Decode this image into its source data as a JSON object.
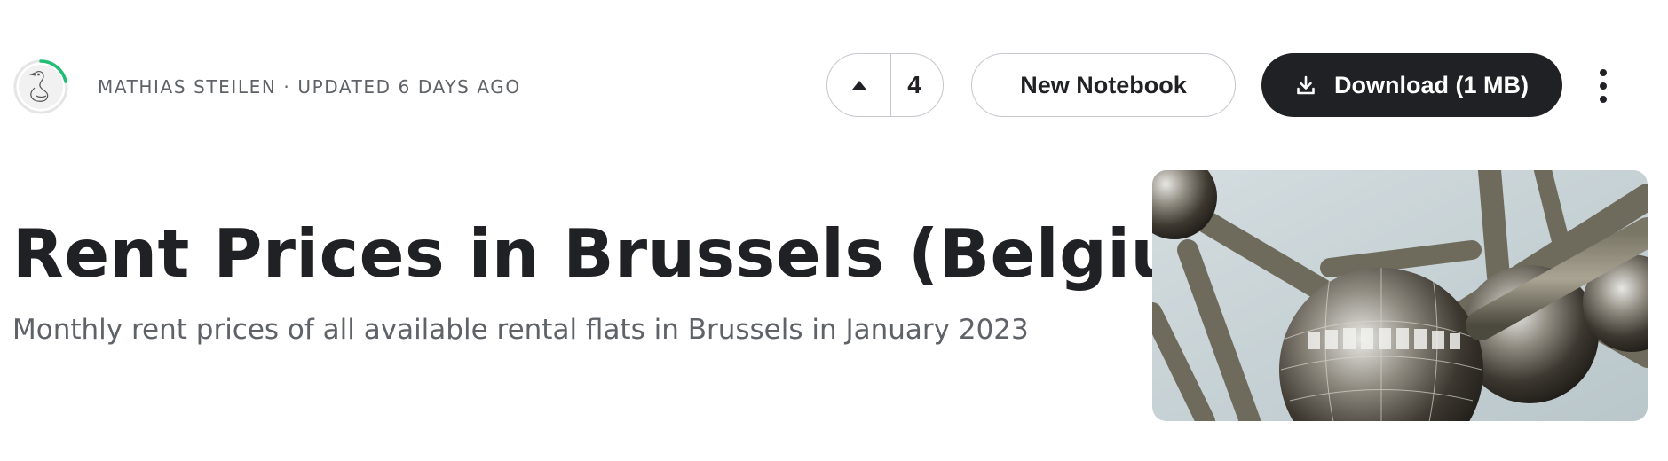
{
  "header": {
    "byline": "MATHIAS STEILEN · UPDATED 6 DAYS AGO",
    "upvote_count": "4",
    "new_notebook_label": "New Notebook",
    "download_label": "Download (1 MB)"
  },
  "dataset": {
    "title": "Rent Prices in Brussels (Belgium)",
    "subtitle": "Monthly rent prices of all available rental flats in Brussels in January 2023"
  },
  "colors": {
    "primary_dark": "#202124",
    "muted_text": "#5f6368",
    "progress_ring": "#20be75",
    "border": "#c4c7cc"
  },
  "icons": {
    "avatar": "goose-avatar",
    "upvote": "triangle-up-icon",
    "download": "download-icon",
    "more": "kebab-menu-icon"
  }
}
